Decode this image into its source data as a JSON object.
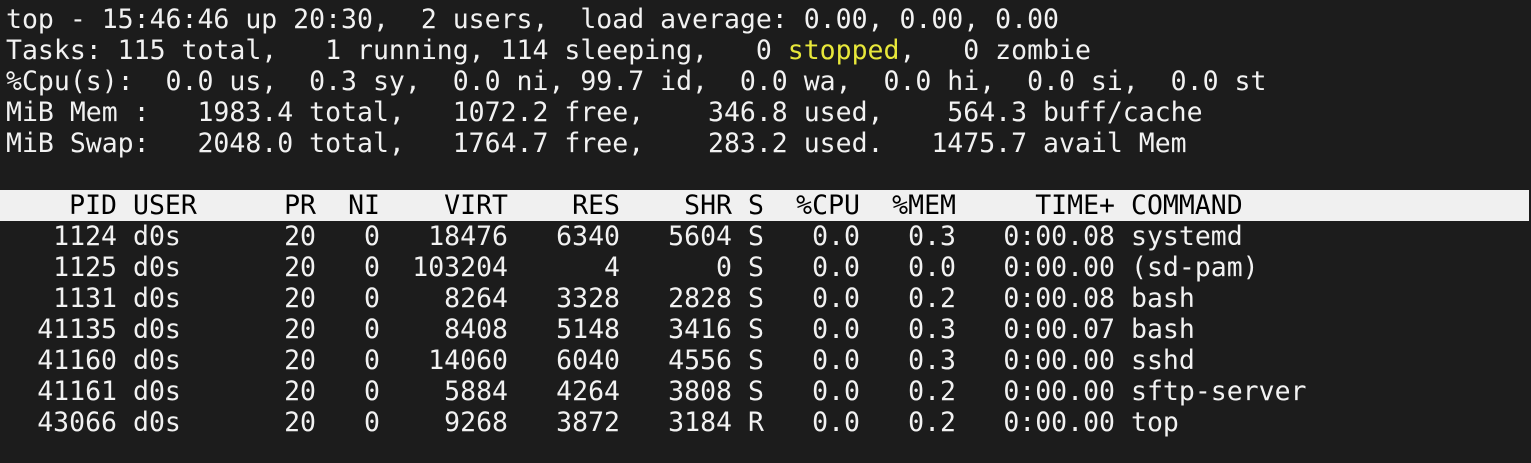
{
  "summary": {
    "uptime_line": "top - 15:46:46 up 20:30,  2 users,  load average: 0.00, 0.00, 0.00",
    "tasks_before": "Tasks: 115 total,   1 running, 114 sleeping,   0 ",
    "tasks_stopped_label": "stopped",
    "tasks_after": ",   0 zombie",
    "cpu_line": "%Cpu(s):  0.0 us,  0.3 sy,  0.0 ni, 99.7 id,  0.0 wa,  0.0 hi,  0.0 si,  0.0 st",
    "mem_line": "MiB Mem :   1983.4 total,   1072.2 free,    346.8 used,    564.3 buff/cache",
    "swap_line": "MiB Swap:   2048.0 total,   1764.7 free,    283.2 used.   1475.7 avail Mem"
  },
  "columns": {
    "pid": "PID",
    "user": "USER",
    "pr": "PR",
    "ni": "NI",
    "virt": "VIRT",
    "res": "RES",
    "shr": "SHR",
    "s": "S",
    "cpu": "%CPU",
    "mem": "%MEM",
    "time": "TIME+",
    "command": "COMMAND"
  },
  "processes": [
    {
      "pid": "1124",
      "user": "d0s",
      "pr": "20",
      "ni": "0",
      "virt": "18476",
      "res": "6340",
      "shr": "5604",
      "s": "S",
      "cpu": "0.0",
      "mem": "0.3",
      "time": "0:00.08",
      "command": "systemd"
    },
    {
      "pid": "1125",
      "user": "d0s",
      "pr": "20",
      "ni": "0",
      "virt": "103204",
      "res": "4",
      "shr": "0",
      "s": "S",
      "cpu": "0.0",
      "mem": "0.0",
      "time": "0:00.00",
      "command": "(sd-pam)"
    },
    {
      "pid": "1131",
      "user": "d0s",
      "pr": "20",
      "ni": "0",
      "virt": "8264",
      "res": "3328",
      "shr": "2828",
      "s": "S",
      "cpu": "0.0",
      "mem": "0.2",
      "time": "0:00.08",
      "command": "bash"
    },
    {
      "pid": "41135",
      "user": "d0s",
      "pr": "20",
      "ni": "0",
      "virt": "8408",
      "res": "5148",
      "shr": "3416",
      "s": "S",
      "cpu": "0.0",
      "mem": "0.3",
      "time": "0:00.07",
      "command": "bash"
    },
    {
      "pid": "41160",
      "user": "d0s",
      "pr": "20",
      "ni": "0",
      "virt": "14060",
      "res": "6040",
      "shr": "4556",
      "s": "S",
      "cpu": "0.0",
      "mem": "0.3",
      "time": "0:00.00",
      "command": "sshd"
    },
    {
      "pid": "41161",
      "user": "d0s",
      "pr": "20",
      "ni": "0",
      "virt": "5884",
      "res": "4264",
      "shr": "3808",
      "s": "S",
      "cpu": "0.0",
      "mem": "0.2",
      "time": "0:00.00",
      "command": "sftp-server"
    },
    {
      "pid": "43066",
      "user": "d0s",
      "pr": "20",
      "ni": "0",
      "virt": "9268",
      "res": "3872",
      "shr": "3184",
      "s": "R",
      "cpu": "0.0",
      "mem": "0.2",
      "time": "0:00.00",
      "command": "top"
    }
  ],
  "colors": {
    "background": "#1c1c1c",
    "foreground": "#f2f2f2",
    "header_bg": "#f0f0f0",
    "header_fg": "#000000",
    "stopped_highlight": "#e8e83a"
  }
}
